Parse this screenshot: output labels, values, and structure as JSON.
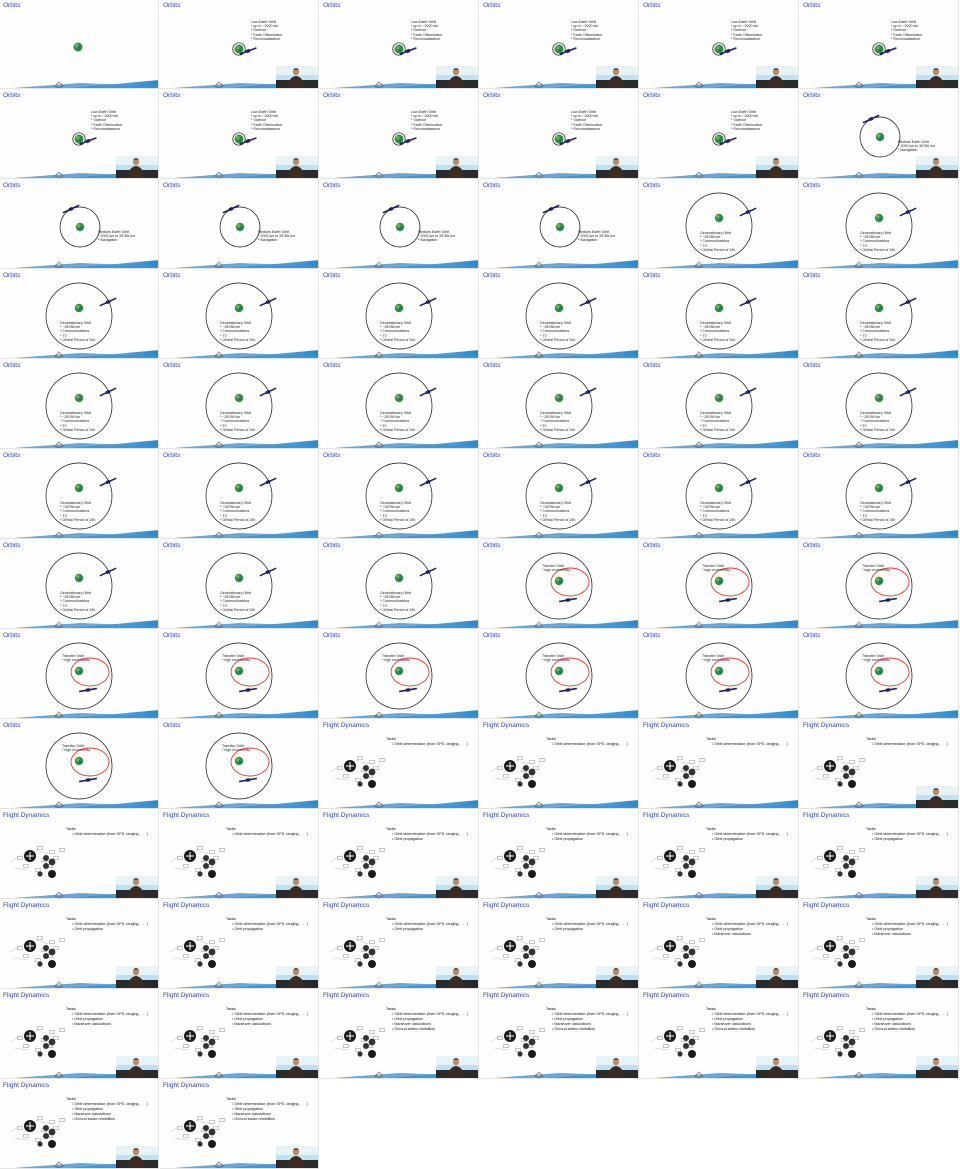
{
  "titles": {
    "orbits": "Orbits",
    "flight": "Flight Dynamics"
  },
  "leo": {
    "title": "Low-Earth Orbit",
    "items": [
      "* up to ~2000 km",
      "* Science",
      "* Earth Observation",
      "* Reconnaissance"
    ]
  },
  "meo": {
    "title": "Medium Earth Orbit",
    "items": [
      "* 2000 km to 35786 km",
      "* Navigation"
    ]
  },
  "geo": {
    "title": "Geostationary Orbit",
    "items": [
      "* ~35786 km",
      "* Communications",
      "* TV",
      "* Orbital Period of 24h"
    ]
  },
  "gto": {
    "title": "Transfer Orbit",
    "items": [
      "* high eccentricity"
    ]
  },
  "flight_dynamics": {
    "tasks_label": "Tasks:",
    "tasks": [
      "Orbit determination (from GPS, ranging, . . . )",
      "Orbit propagation",
      "Maneuver calculations",
      "Ground station visibilities"
    ]
  },
  "frames": [
    {
      "kind": "orbit",
      "stage": "earth"
    },
    {
      "kind": "orbit",
      "stage": "leo",
      "cam": true
    },
    {
      "kind": "orbit",
      "stage": "leo",
      "cam": true
    },
    {
      "kind": "orbit",
      "stage": "leo",
      "cam": true
    },
    {
      "kind": "orbit",
      "stage": "leo",
      "cam": true
    },
    {
      "kind": "orbit",
      "stage": "leo",
      "cam": true
    },
    {
      "kind": "orbit",
      "stage": "leo",
      "cam": true
    },
    {
      "kind": "orbit",
      "stage": "leo",
      "cam": true
    },
    {
      "kind": "orbit",
      "stage": "leo",
      "cam": true
    },
    {
      "kind": "orbit",
      "stage": "leo",
      "cam": true
    },
    {
      "kind": "orbit",
      "stage": "leo",
      "cam": true
    },
    {
      "kind": "orbit",
      "stage": "meo",
      "cam": true
    },
    {
      "kind": "orbit",
      "stage": "meo"
    },
    {
      "kind": "orbit",
      "stage": "meo"
    },
    {
      "kind": "orbit",
      "stage": "meo"
    },
    {
      "kind": "orbit",
      "stage": "meo"
    },
    {
      "kind": "orbit",
      "stage": "geo"
    },
    {
      "kind": "orbit",
      "stage": "geo"
    },
    {
      "kind": "orbit",
      "stage": "geo"
    },
    {
      "kind": "orbit",
      "stage": "geo"
    },
    {
      "kind": "orbit",
      "stage": "geo"
    },
    {
      "kind": "orbit",
      "stage": "geo"
    },
    {
      "kind": "orbit",
      "stage": "geo"
    },
    {
      "kind": "orbit",
      "stage": "geo"
    },
    {
      "kind": "orbit",
      "stage": "geo"
    },
    {
      "kind": "orbit",
      "stage": "geo"
    },
    {
      "kind": "orbit",
      "stage": "geo"
    },
    {
      "kind": "orbit",
      "stage": "geo"
    },
    {
      "kind": "orbit",
      "stage": "geo"
    },
    {
      "kind": "orbit",
      "stage": "geo"
    },
    {
      "kind": "orbit",
      "stage": "geo"
    },
    {
      "kind": "orbit",
      "stage": "geo"
    },
    {
      "kind": "orbit",
      "stage": "geo"
    },
    {
      "kind": "orbit",
      "stage": "geo"
    },
    {
      "kind": "orbit",
      "stage": "geo"
    },
    {
      "kind": "orbit",
      "stage": "geo"
    },
    {
      "kind": "orbit",
      "stage": "geo"
    },
    {
      "kind": "orbit",
      "stage": "geo"
    },
    {
      "kind": "orbit",
      "stage": "geo"
    },
    {
      "kind": "orbit",
      "stage": "gto"
    },
    {
      "kind": "orbit",
      "stage": "gto"
    },
    {
      "kind": "orbit",
      "stage": "gto"
    },
    {
      "kind": "orbit",
      "stage": "gto"
    },
    {
      "kind": "orbit",
      "stage": "gto"
    },
    {
      "kind": "orbit",
      "stage": "gto"
    },
    {
      "kind": "orbit",
      "stage": "gto"
    },
    {
      "kind": "orbit",
      "stage": "gto"
    },
    {
      "kind": "orbit",
      "stage": "gto"
    },
    {
      "kind": "orbit",
      "stage": "gto"
    },
    {
      "kind": "orbit",
      "stage": "gto"
    },
    {
      "kind": "fd",
      "tasks": 1
    },
    {
      "kind": "fd",
      "tasks": 1
    },
    {
      "kind": "fd",
      "tasks": 1
    },
    {
      "kind": "fd",
      "tasks": 1,
      "cam": true
    },
    {
      "kind": "fd",
      "tasks": 1,
      "cam": true
    },
    {
      "kind": "fd",
      "tasks": 1,
      "cam": true
    },
    {
      "kind": "fd",
      "tasks": 2,
      "cam": true
    },
    {
      "kind": "fd",
      "tasks": 2,
      "cam": true
    },
    {
      "kind": "fd",
      "tasks": 2,
      "cam": true
    },
    {
      "kind": "fd",
      "tasks": 2,
      "cam": true
    },
    {
      "kind": "fd",
      "tasks": 2,
      "cam": true
    },
    {
      "kind": "fd",
      "tasks": 2,
      "cam": true
    },
    {
      "kind": "fd",
      "tasks": 2,
      "cam": true
    },
    {
      "kind": "fd",
      "tasks": 2,
      "cam": true
    },
    {
      "kind": "fd",
      "tasks": 3,
      "cam": true
    },
    {
      "kind": "fd",
      "tasks": 3,
      "cam": true
    },
    {
      "kind": "fd",
      "tasks": 3,
      "cam": true
    },
    {
      "kind": "fd",
      "tasks": 3,
      "cam": true
    },
    {
      "kind": "fd",
      "tasks": 4,
      "cam": true
    },
    {
      "kind": "fd",
      "tasks": 4,
      "cam": true
    },
    {
      "kind": "fd",
      "tasks": 4,
      "cam": true
    },
    {
      "kind": "fd",
      "tasks": 4,
      "cam": true
    },
    {
      "kind": "fd",
      "tasks": 4,
      "cam": true
    },
    {
      "kind": "fd",
      "tasks": 4,
      "cam": true
    }
  ],
  "colors": {
    "title": "#2f3fbf",
    "orbit": "#111111",
    "transfer": "#e8402a",
    "earth": "#2f8f3a",
    "sat": "#1a1f6e"
  }
}
